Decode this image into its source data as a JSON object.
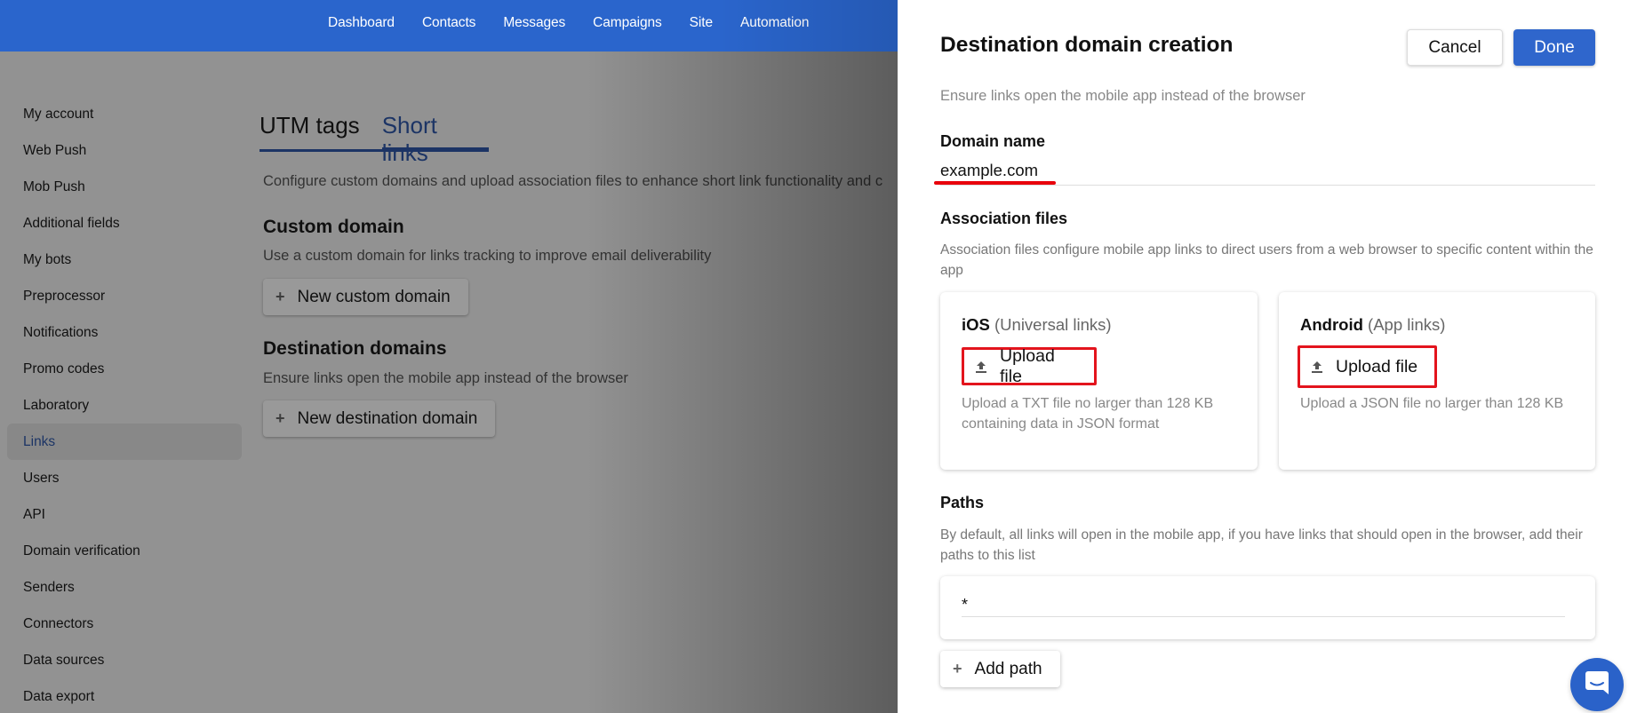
{
  "topnav": {
    "items": [
      {
        "label": "Dashboard"
      },
      {
        "label": "Contacts"
      },
      {
        "label": "Messages"
      },
      {
        "label": "Campaigns"
      },
      {
        "label": "Site"
      },
      {
        "label": "Automation"
      }
    ]
  },
  "sidebar": {
    "active": "Links",
    "items": [
      {
        "label": "My account"
      },
      {
        "label": "Web Push"
      },
      {
        "label": "Mob Push"
      },
      {
        "label": "Additional fields"
      },
      {
        "label": "My bots"
      },
      {
        "label": "Preprocessor"
      },
      {
        "label": "Notifications"
      },
      {
        "label": "Promo codes"
      },
      {
        "label": "Laboratory"
      },
      {
        "label": "Links"
      },
      {
        "label": "Users"
      },
      {
        "label": "API"
      },
      {
        "label": "Domain verification"
      },
      {
        "label": "Senders"
      },
      {
        "label": "Connectors"
      },
      {
        "label": "Data sources"
      },
      {
        "label": "Data export"
      }
    ]
  },
  "main": {
    "tabs": [
      {
        "label": "UTM tags",
        "active": false
      },
      {
        "label": "Short links",
        "active": true
      }
    ],
    "description": "Configure custom domains and upload association files to enhance short link functionality and c",
    "custom_domain": {
      "title": "Custom domain",
      "description": "Use a custom domain for links tracking to improve email deliverability",
      "button_label": "New custom domain"
    },
    "destination_domains": {
      "title": "Destination domains",
      "description": "Ensure links open the mobile app instead of the browser",
      "button_label": "New destination domain"
    }
  },
  "panel": {
    "title": "Destination domain creation",
    "cancel_label": "Cancel",
    "done_label": "Done",
    "subtitle": "Ensure links open the mobile app instead of the browser",
    "domain_name": {
      "label": "Domain name",
      "value": "example.com"
    },
    "association_files": {
      "title": "Association files",
      "description": "Association files configure mobile app links to direct users from a web browser to specific content within the app",
      "ios": {
        "platform": "iOS",
        "subtitle": "(Universal links)",
        "upload_label": "Upload file",
        "hint": "Upload a TXT file no larger than 128 KB containing data in JSON format"
      },
      "android": {
        "platform": "Android",
        "subtitle": "(App links)",
        "upload_label": "Upload file",
        "hint": "Upload a JSON file no larger than 128 KB"
      }
    },
    "paths": {
      "title": "Paths",
      "description": "By default, all links will open in the mobile app, if you have links that should open in the browser, add their paths to this list",
      "items": [
        {
          "value": "*"
        }
      ],
      "add_label": "Add path"
    }
  },
  "colors": {
    "header": "#2a65cc",
    "accent": "#2e57a8",
    "primary_button": "#2f66cc",
    "highlight_red": "#e3141d"
  },
  "icons": {
    "add": "plus-icon",
    "upload": "upload-icon",
    "chat": "chat-icon"
  }
}
